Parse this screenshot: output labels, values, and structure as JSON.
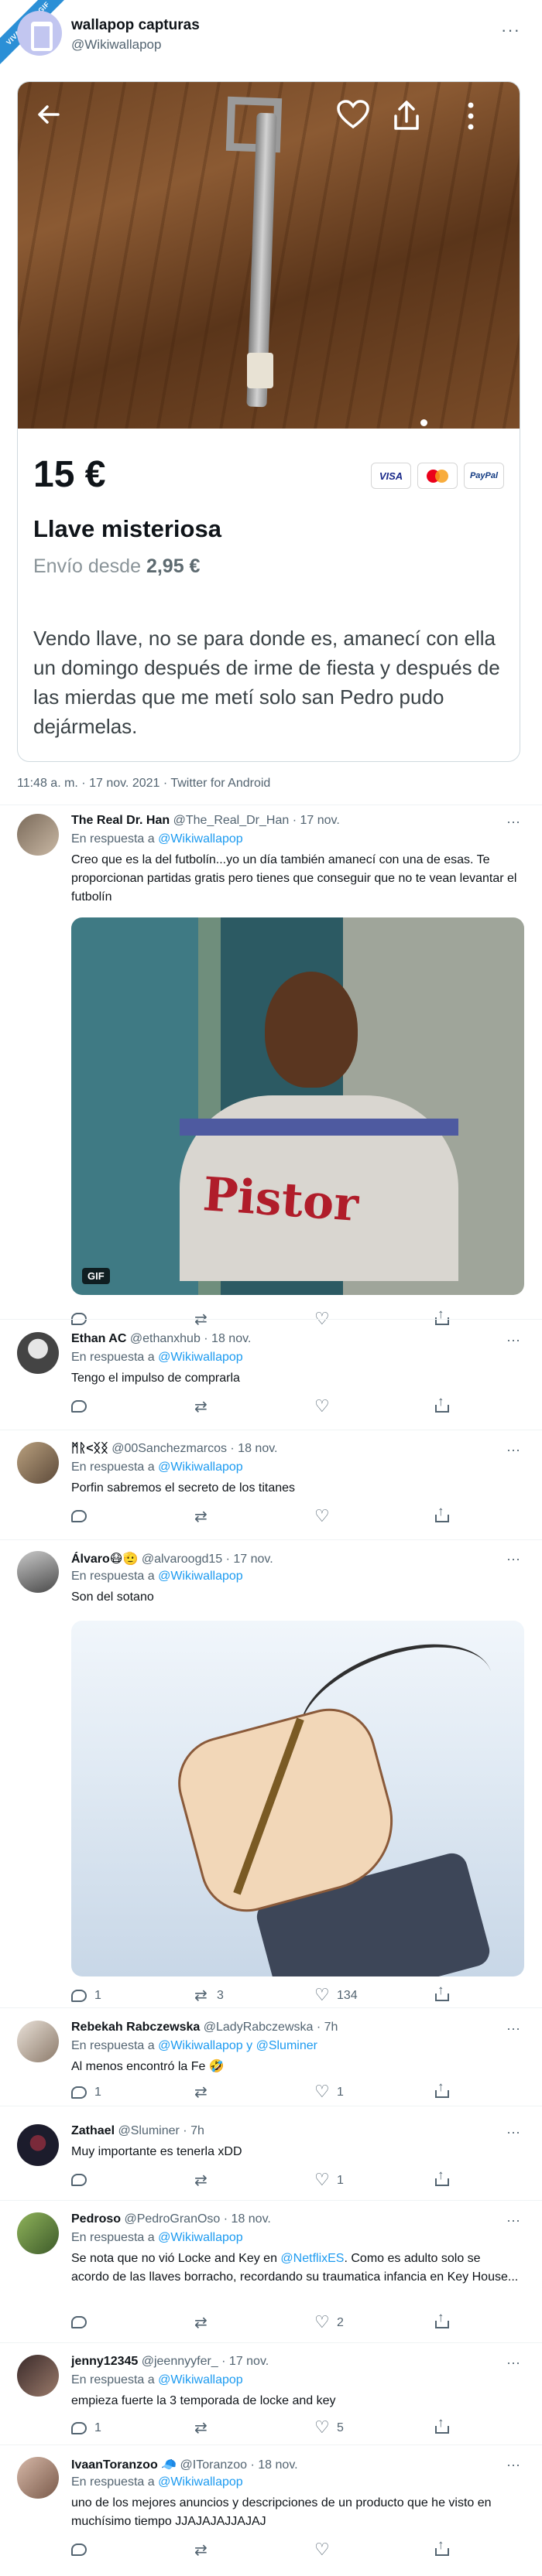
{
  "ribbon": {
    "text": "VIVALAVIDAGIF"
  },
  "account": {
    "name": "wallapop capturas",
    "handle": "@Wikiwallapop",
    "more": "···"
  },
  "listing": {
    "price": "15 €",
    "payment_badges": [
      "VISA",
      "",
      "PayPal"
    ],
    "title": "Llave misteriosa",
    "shipping_prefix": "Envío desde",
    "shipping_price": "2,95 €",
    "description": "Vendo llave, no se para donde es, amanecí con ella un domingo después de irme de fiesta y después de las mierdas que me metí solo san Pedro pudo dejármelas.",
    "photo_buttons": {
      "back": "back-arrow-icon",
      "fav": "heart-icon",
      "share": "share-icon",
      "menu": "more-vertical-icon"
    }
  },
  "tweet_meta": "11:48 a. m. · 17 nov. 2021 · Twitter for Android",
  "replies": [
    {
      "name": "The Real Dr. Han",
      "handle": "@The_Real_Dr_Han · 17 nov.",
      "resp_prefix": "En respuesta a",
      "resp_to": "@Wikiwallapop",
      "text": "Creo que es la del futbolín...yo un día también amanecí con una de esas. Te proporcionan partidas gratis pero tienes que conseguir que no te vean levantar el futbolín",
      "media_tag": "GIF",
      "gif_word": "Pistor",
      "counts": {
        "reply": "",
        "retweet": "",
        "like": ""
      }
    },
    {
      "name": "Ethan AC",
      "handle": "@ethanxhub · 18 nov.",
      "resp_prefix": "En respuesta a",
      "resp_to": "@Wikiwallapop",
      "text": "Tengo el impulso de comprarla",
      "counts": {
        "reply": "",
        "retweet": "",
        "like": ""
      }
    },
    {
      "name": "ᛗᚱ<ᛝᛝ",
      "handle": "@00Sanchezmarcos · 18 nov.",
      "resp_prefix": "En respuesta a",
      "resp_to": "@Wikiwallapop",
      "text": "Porfin sabremos el secreto de los titanes",
      "counts": {
        "reply": "",
        "retweet": "",
        "like": ""
      }
    },
    {
      "name": "Álvaro😷🫡",
      "handle": "@alvaroogd15 · 17 nov.",
      "resp_prefix": "En respuesta a",
      "resp_to": "@Wikiwallapop",
      "text": "Son del sotano",
      "counts": {
        "reply": "1",
        "retweet": "3",
        "like": "134"
      }
    },
    {
      "name": "Rebekah Rabczewska",
      "handle": "@LadyRabczewska · 7h",
      "resp_prefix": "En respuesta a",
      "resp_to": "@Wikiwallapop y @Sluminer",
      "text": "Al menos encontró la Fe 🤣",
      "counts": {
        "reply": "1",
        "retweet": "",
        "like": "1"
      }
    },
    {
      "name": "Zathael",
      "handle": "@Sluminer · 7h",
      "resp_prefix": "",
      "resp_to": "",
      "text": "Muy importante es tenerla xDD",
      "counts": {
        "reply": "",
        "retweet": "",
        "like": "1"
      }
    },
    {
      "name": "Pedroso",
      "handle": "@PedroGranOso · 18 nov.",
      "resp_prefix": "En respuesta a",
      "resp_to": "@Wikiwallapop",
      "text_a": "Se nota que no vió Locke and Key en ",
      "text_link": "@NetflixES",
      "text_b": ". Como es adulto solo se acordo de las llaves borracho, recordando su traumatica infancia en Key House...",
      "counts": {
        "reply": "",
        "retweet": "",
        "like": "2"
      }
    },
    {
      "name": "jenny12345",
      "handle": "@jeennyyfer_ · 17 nov.",
      "resp_prefix": "En respuesta a",
      "resp_to": "@Wikiwallapop",
      "text": "empieza fuerte la 3 temporada de locke and key",
      "counts": {
        "reply": "1",
        "retweet": "",
        "like": "5"
      }
    },
    {
      "name": "IvaanToranzoo 🧢",
      "handle": "@IToranzoo · 18 nov.",
      "resp_prefix": "En respuesta a",
      "resp_to": "@Wikiwallapop",
      "text": "uno de los mejores anuncios y descripciones de un producto que he visto en muchísimo tiempo JJAJAJAJJAJAJ",
      "counts": {
        "reply": "",
        "retweet": "",
        "like": ""
      }
    }
  ],
  "colors": {
    "link": "#1d9bf0",
    "muted": "#536471",
    "text": "#0f1419"
  }
}
